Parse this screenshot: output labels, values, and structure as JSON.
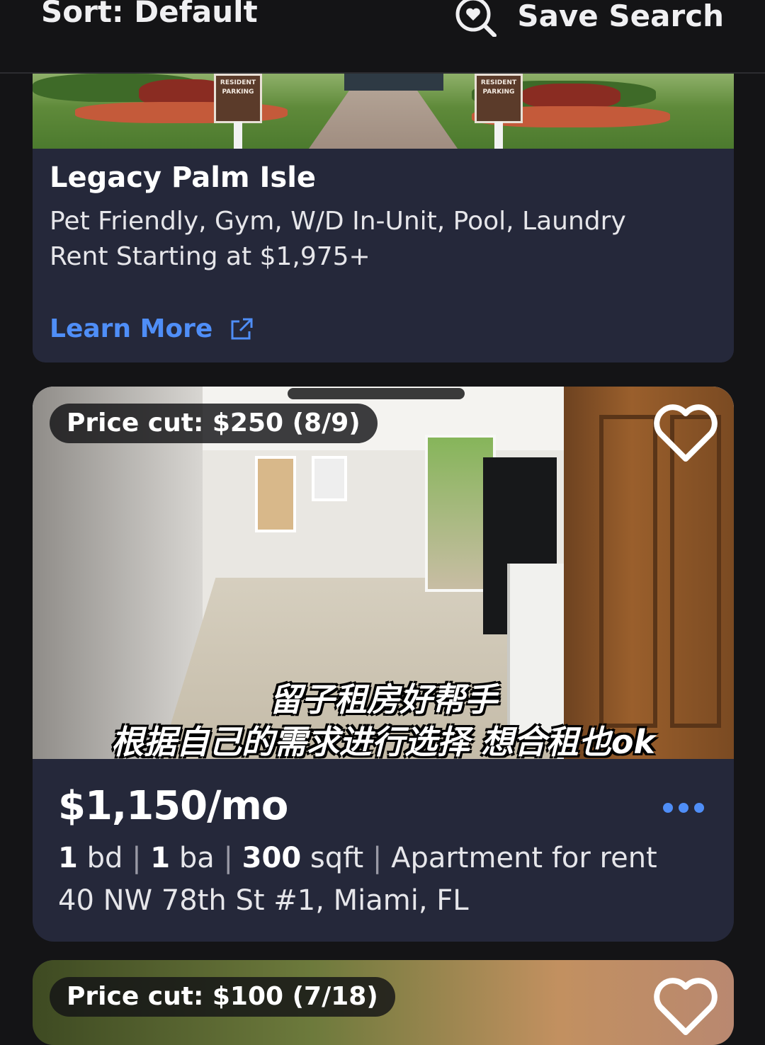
{
  "header": {
    "sort_label": "Sort: Default",
    "save_search_label": "Save Search",
    "save_search_icon": "heart-search-icon"
  },
  "listings": [
    {
      "title": "Legacy Palm Isle",
      "amenities": "Pet Friendly, Gym, W/D In-Unit, Pool, Laundry",
      "rent": "Rent Starting at $1,975+",
      "learn_more": "Learn More",
      "sign_text": "RESIDENT PARKING",
      "external_icon": "external-link-icon"
    },
    {
      "badge": "Price cut: $250 (8/9)",
      "overlay_line1": "留子租房好帮手",
      "overlay_line2": "根据自己的需求进行选择 想合租也ok",
      "price": "$1,150/mo",
      "beds": "1",
      "beds_unit": "bd",
      "baths": "1",
      "baths_unit": "ba",
      "sqft": "300",
      "sqft_unit": "sqft",
      "type": "Apartment for rent",
      "address": "40 NW 78th St #1, Miami, FL"
    },
    {
      "badge": "Price cut: $100 (7/18)"
    }
  ],
  "colors": {
    "background": "#141416",
    "card": "#25283a",
    "accent": "#4f8ef7"
  }
}
